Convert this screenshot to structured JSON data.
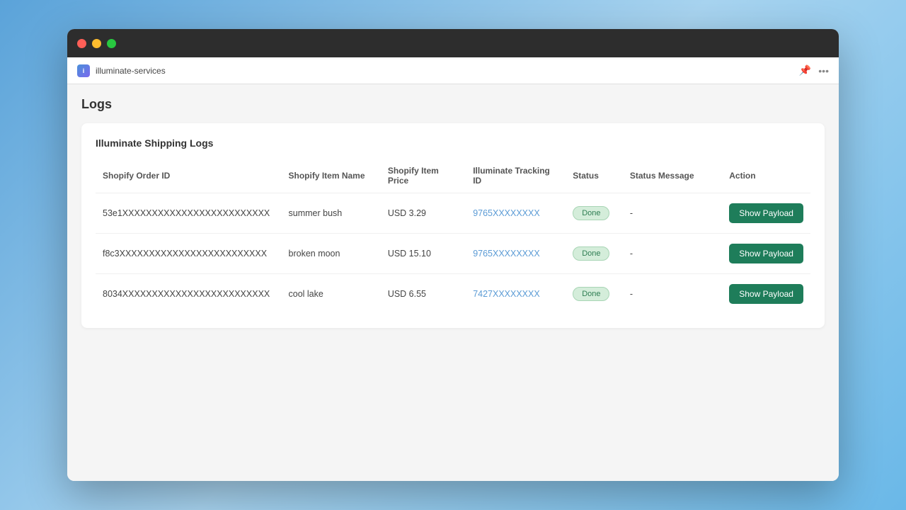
{
  "window": {
    "app_icon_label": "i",
    "app_name": "illuminate-services",
    "page_title": "Logs",
    "card_title": "Illuminate Shipping Logs"
  },
  "toolbar": {
    "pin_icon": "📌",
    "more_icon": "···"
  },
  "table": {
    "columns": [
      "Shopify Order ID",
      "Shopify Item Name",
      "Shopify Item Price",
      "Illuminate Tracking ID",
      "Status",
      "Status Message",
      "Action"
    ],
    "rows": [
      {
        "order_id": "53e1XXXXXXXXXXXXXXXXXXXXXXXXX",
        "item_name": "summer bush",
        "item_price": "USD 3.29",
        "tracking_id": "9765XXXXXXXX",
        "status": "Done",
        "status_message": "-",
        "action": "Show Payload"
      },
      {
        "order_id": "f8c3XXXXXXXXXXXXXXXXXXXXXXXXX",
        "item_name": "broken moon",
        "item_price": "USD 15.10",
        "tracking_id": "9765XXXXXXXX",
        "status": "Done",
        "status_message": "-",
        "action": "Show Payload"
      },
      {
        "order_id": "8034XXXXXXXXXXXXXXXXXXXXXXXXX",
        "item_name": "cool lake",
        "item_price": "USD 6.55",
        "tracking_id": "7427XXXXXXXX",
        "status": "Done",
        "status_message": "-",
        "action": "Show Payload"
      }
    ]
  }
}
